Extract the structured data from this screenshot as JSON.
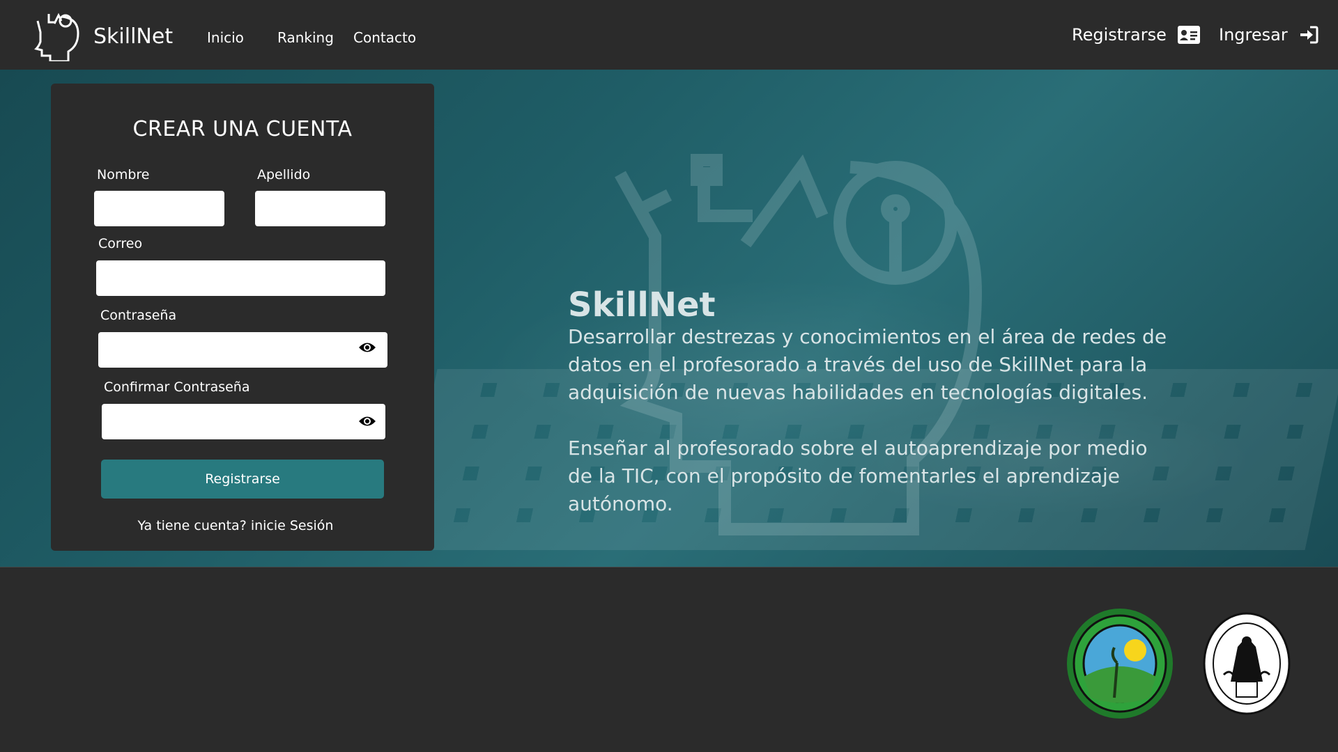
{
  "brand": {
    "name": "SkillNet",
    "logo_icon": "head-ideas-icon"
  },
  "nav": {
    "links": [
      "Inicio",
      "Ranking",
      "Contacto"
    ],
    "register_label": "Registrarse",
    "register_icon": "id-card-icon",
    "login_label": "Ingresar",
    "login_icon": "sign-in-icon"
  },
  "form": {
    "title": "CREAR UNA CUENTA",
    "first_name_label": "Nombre",
    "last_name_label": "Apellido",
    "email_label": "Correo",
    "password_label": "Contraseña",
    "confirm_password_label": "Confirmar Contraseña",
    "first_name_value": "",
    "last_name_value": "",
    "email_value": "",
    "password_value": "",
    "confirm_password_value": "",
    "submit_label": "Registrarse",
    "login_link": "Ya tiene cuenta? inicie Sesión"
  },
  "hero": {
    "title": "SkillNet",
    "paragraph1": "Desarrollar destrezas y conocimientos en el área de redes de datos en el profesorado a través del uso de SkillNet para la adquisición de nuevas habilidades en tecnologías digitales.",
    "paragraph2": "Enseñar al profesorado sobre el autoaprendizaje por medio de la TIC, con el propósito de fomentarles el aprendizaje autónomo."
  },
  "footer": {
    "seals": [
      "green-laurel-seal",
      "university-seal"
    ]
  },
  "colors": {
    "background": "#2b2b2b",
    "accent": "#287a7f",
    "hero_teal": "#1f5d66"
  }
}
